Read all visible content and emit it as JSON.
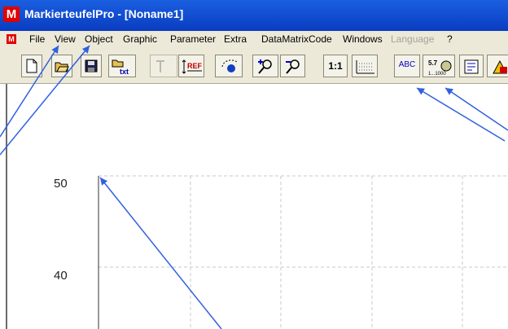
{
  "window": {
    "title": "MarkierteufelPro - [Noname1]",
    "logo_letter": "M",
    "colors": {
      "titlebar": "#0a3cc0",
      "logo": "#e00000",
      "annotation_arrows": "#3060e0"
    }
  },
  "menubar": {
    "items": [
      {
        "label": "File"
      },
      {
        "label": "View"
      },
      {
        "label": "Object"
      },
      {
        "label": "Graphic"
      },
      {
        "label": "Parameter"
      },
      {
        "label": "Extra"
      },
      {
        "label": "DataMatrixCode"
      },
      {
        "label": "Windows"
      },
      {
        "label": "Language",
        "disabled": true
      },
      {
        "label": "?"
      }
    ]
  },
  "toolbar": {
    "buttons": [
      {
        "icon": "new-document-icon"
      },
      {
        "icon": "open-folder-icon"
      },
      {
        "icon": "save-icon"
      },
      {
        "icon": "import-text-icon",
        "text": "txt"
      },
      {
        "icon": "text-object-icon",
        "disabled": true
      },
      {
        "icon": "reference-point-icon",
        "text": "REF"
      },
      {
        "icon": "rotate-object-icon"
      },
      {
        "icon": "zoom-in-icon"
      },
      {
        "icon": "zoom-out-icon"
      },
      {
        "icon": "zoom-actual-size-icon",
        "text": "1:1"
      },
      {
        "icon": "ruler-grid-icon"
      },
      {
        "icon": "insert-text-icon",
        "text": "ABC"
      },
      {
        "icon": "serial-number-icon",
        "text_top": "5.7",
        "text_bottom": "1...1000"
      },
      {
        "icon": "form-field-icon"
      },
      {
        "icon": "color-shapes-icon"
      }
    ]
  },
  "canvas": {
    "y_labels": [
      "50",
      "40"
    ]
  }
}
